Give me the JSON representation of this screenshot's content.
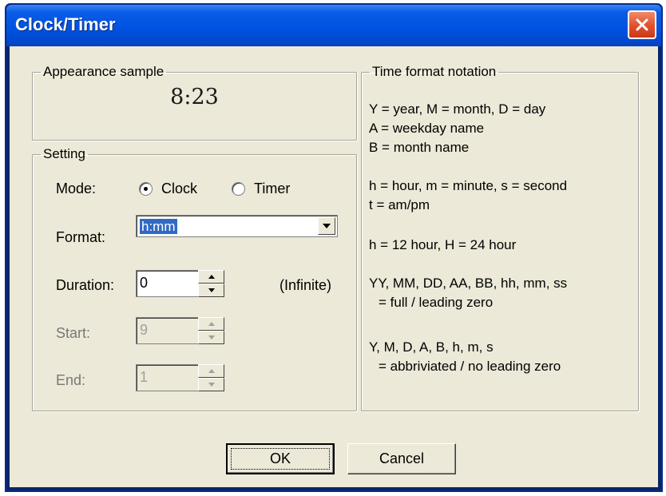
{
  "window": {
    "title": "Clock/Timer"
  },
  "appearance": {
    "legend": "Appearance sample",
    "sample_time": "8:23"
  },
  "setting": {
    "legend": "Setting",
    "mode_label": "Mode:",
    "mode_options": [
      "Clock",
      "Timer"
    ],
    "mode_selected": "Clock",
    "format_label": "Format:",
    "format_value": "h:mm",
    "duration_label": "Duration:",
    "duration_value": "0",
    "duration_note": "(Infinite)",
    "start_label": "Start:",
    "start_value": "9",
    "end_label": "End:",
    "end_value": "1"
  },
  "notation": {
    "legend": "Time format notation",
    "lines": [
      "Y = year, M = month, D = day",
      "A = weekday name",
      "B = month name",
      "h = hour, m = minute, s = second",
      "t = am/pm",
      "h = 12 hour, H = 24 hour",
      "YY, MM, DD, AA, BB, hh, mm, ss",
      "= full / leading zero",
      "Y, M, D, A, B, h, m, s",
      "= abbriviated / no leading zero"
    ]
  },
  "buttons": {
    "ok": "OK",
    "cancel": "Cancel"
  },
  "icons": {
    "close": "close-x-icon",
    "dropdown": "chevron-down-icon",
    "spin_up": "triangle-up-icon",
    "spin_down": "triangle-down-icon"
  },
  "colors": {
    "titlebar": "#0053e1",
    "close_button": "#e0502c",
    "dialog_face": "#ece9d8",
    "selection": "#316ac5"
  }
}
